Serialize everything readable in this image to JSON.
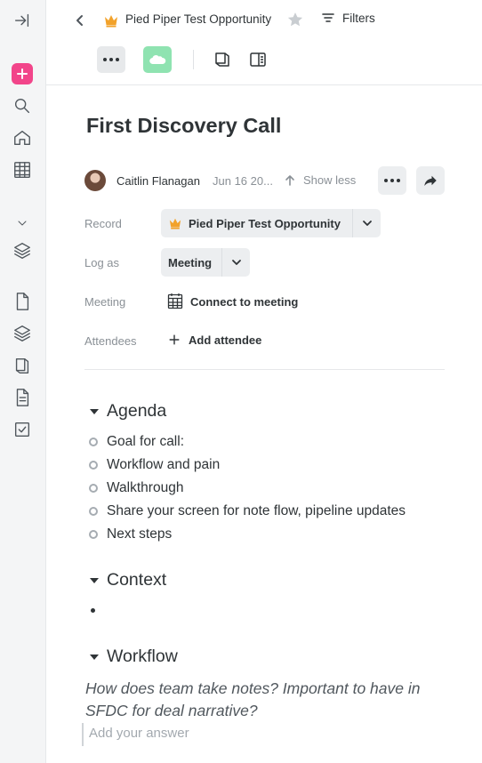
{
  "rail": {
    "icons": [
      "collapse-sidebar-icon",
      "new-icon",
      "search-icon",
      "home-icon",
      "grid-icon",
      "chevron-down-icon",
      "layers-icon",
      "document-icon",
      "layers-icon",
      "notebook-icon",
      "notes-icon",
      "checkbox-icon"
    ],
    "accent": "#f2458a"
  },
  "header": {
    "opportunity_title": "Pied Piper Test Opportunity",
    "filters_label": "Filters",
    "salesforce_color": "#8fe3b1"
  },
  "note": {
    "title": "First Discovery Call",
    "author": "Caitlin Flanagan",
    "date": "Jun 16 20...",
    "show_less": "Show less"
  },
  "fields": {
    "record_label": "Record",
    "record_value": "Pied Piper Test Opportunity",
    "log_as_label": "Log as",
    "log_as_value": "Meeting",
    "meeting_label": "Meeting",
    "meeting_action": "Connect to meeting",
    "attendees_label": "Attendees",
    "attendees_action": "Add attendee"
  },
  "sections": {
    "agenda": {
      "heading": "Agenda",
      "items": [
        "Goal for call:",
        "Workflow and pain",
        "Walkthrough",
        "Share your screen for note flow, pipeline updates",
        "Next steps"
      ]
    },
    "context": {
      "heading": "Context"
    },
    "workflow": {
      "heading": "Workflow",
      "question": "How does team take notes? Important to have in SFDC for deal narrative?",
      "answer_placeholder": "Add your answer"
    }
  },
  "colors": {
    "crown": "#f2a22b",
    "text": "#2f3437",
    "muted": "#8a9096"
  }
}
